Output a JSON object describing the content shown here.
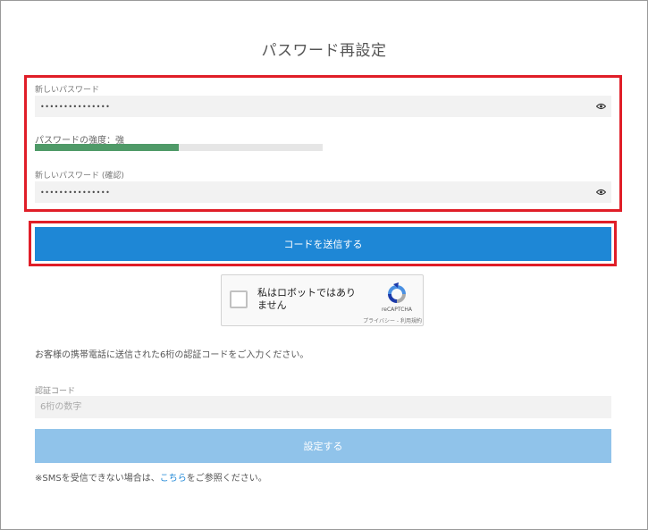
{
  "page": {
    "title": "パスワード再設定"
  },
  "new_password": {
    "label": "新しいパスワード",
    "value": "•••••••••••••••",
    "eye_icon": "eye-icon"
  },
  "strength": {
    "label": "パスワードの強度：強",
    "level": 0.5,
    "color": "#4f9a68"
  },
  "confirm_password": {
    "label": "新しいパスワード (確認)",
    "value": "•••••••••••••••",
    "eye_icon": "eye-icon"
  },
  "send_code": {
    "label": "コードを送信する",
    "color": "#1e87d6"
  },
  "recaptcha": {
    "label": "私はロボットではありません",
    "brand": "reCAPTCHA",
    "privacy": "プライバシー",
    "separator": " - ",
    "terms": "利用規約"
  },
  "instruction": "お客様の携帯電話に送信された6桁の認証コードをご入力ください。",
  "verification_code": {
    "label": "認証コード",
    "placeholder": "6桁の数字",
    "value": ""
  },
  "submit": {
    "label": "設定する",
    "color": "#90c3ea"
  },
  "sms_note": {
    "prefix": "※SMSを受信できない場合は、",
    "link": "こちら",
    "suffix": "をご参照ください。"
  },
  "highlight_color": "#e01e28"
}
